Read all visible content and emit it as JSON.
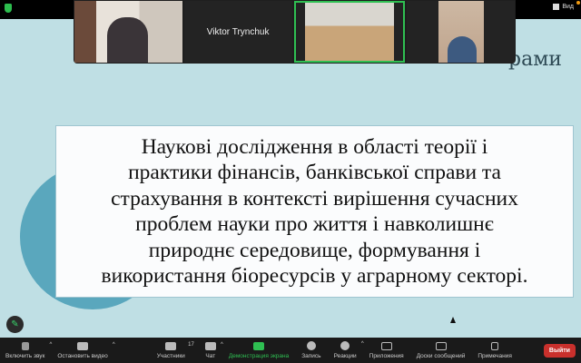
{
  "topbar": {
    "view_label": "Вид"
  },
  "participants": [
    {
      "name": "Viktor Trynchuk"
    }
  ],
  "slide": {
    "title_fragment": "рами",
    "lines": [
      "Наукові дослідження в області теорії і",
      "практики фінансів, банківської справи та",
      "страхування в контексті  вирішення сучасних",
      "проблем науки про життя і навколишнє",
      "природнє середовище, формування  і",
      "використання біоресурсів у аграрному секторі."
    ]
  },
  "toolbar": {
    "unmute": "Включить звук",
    "video": "Остановить видео",
    "participants": "Участники",
    "participants_count": "17",
    "chat": "Чат",
    "share": "Демонстрация экрана",
    "record": "Запись",
    "reactions": "Реакции",
    "apps": "Приложения",
    "whiteboards": "Доски сообщений",
    "notes": "Примечания",
    "leave": "Выйти"
  }
}
